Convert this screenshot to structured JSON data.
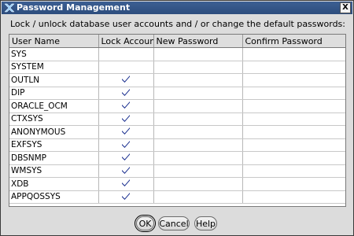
{
  "window": {
    "title": "Password Management",
    "close_label": "X"
  },
  "instructions": "Lock / unlock database user accounts and / or change the default passwords:",
  "table": {
    "headers": [
      "User Name",
      "Lock Account?",
      "New Password",
      "Confirm Password"
    ],
    "rows": [
      {
        "user": "SYS",
        "locked": false,
        "new_password": "",
        "confirm_password": ""
      },
      {
        "user": "SYSTEM",
        "locked": false,
        "new_password": "",
        "confirm_password": ""
      },
      {
        "user": "OUTLN",
        "locked": true,
        "new_password": "",
        "confirm_password": ""
      },
      {
        "user": "DIP",
        "locked": true,
        "new_password": "",
        "confirm_password": ""
      },
      {
        "user": "ORACLE_OCM",
        "locked": true,
        "new_password": "",
        "confirm_password": ""
      },
      {
        "user": "CTXSYS",
        "locked": true,
        "new_password": "",
        "confirm_password": ""
      },
      {
        "user": "ANONYMOUS",
        "locked": true,
        "new_password": "",
        "confirm_password": ""
      },
      {
        "user": "EXFSYS",
        "locked": true,
        "new_password": "",
        "confirm_password": ""
      },
      {
        "user": "DBSNMP",
        "locked": true,
        "new_password": "",
        "confirm_password": ""
      },
      {
        "user": "WMSYS",
        "locked": true,
        "new_password": "",
        "confirm_password": ""
      },
      {
        "user": "XDB",
        "locked": true,
        "new_password": "",
        "confirm_password": ""
      },
      {
        "user": "APPQOSSYS",
        "locked": true,
        "new_password": "",
        "confirm_password": ""
      }
    ]
  },
  "buttons": {
    "ok": "OK",
    "cancel": "Cancel",
    "help": "Help"
  },
  "colors": {
    "titlebar": "#2d4d7d",
    "check": "#1a2f8f"
  }
}
